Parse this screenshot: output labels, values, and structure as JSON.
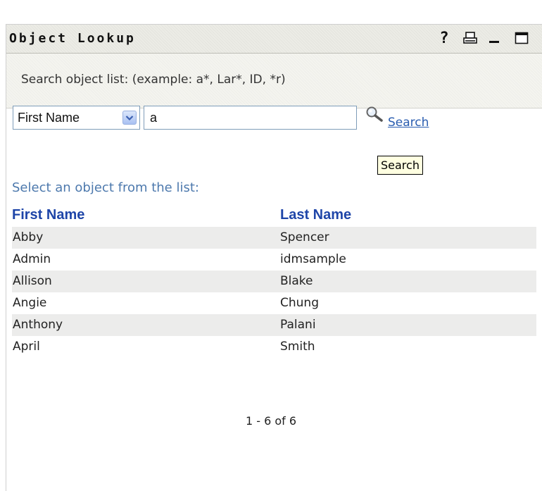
{
  "window": {
    "title": "Object Lookup",
    "controls": {
      "help": "?",
      "print_icon": "print-icon",
      "minimize_icon": "minimize-icon",
      "maximize_icon": "maximize-icon"
    }
  },
  "search": {
    "hint": "Search object list: (example: a*, Lar*, ID, *r)",
    "field_selected": "First Name",
    "query_value": "a",
    "button_label": "Search",
    "tooltip": "Search"
  },
  "list": {
    "caption": "Select an object from the list:",
    "columns": [
      "First Name",
      "Last Name"
    ],
    "rows": [
      {
        "first": "Abby",
        "last": "Spencer"
      },
      {
        "first": "Admin",
        "last": "idmsample"
      },
      {
        "first": "Allison",
        "last": "Blake"
      },
      {
        "first": "Angie",
        "last": "Chung"
      },
      {
        "first": "Anthony",
        "last": "Palani"
      },
      {
        "first": "April",
        "last": "Smith"
      }
    ],
    "pagination": "1 - 6 of 6"
  },
  "colors": {
    "header_text": "#1e45a8",
    "caption_text": "#4d79ad",
    "link": "#2a5db0",
    "row_shade": "#ececeb"
  }
}
